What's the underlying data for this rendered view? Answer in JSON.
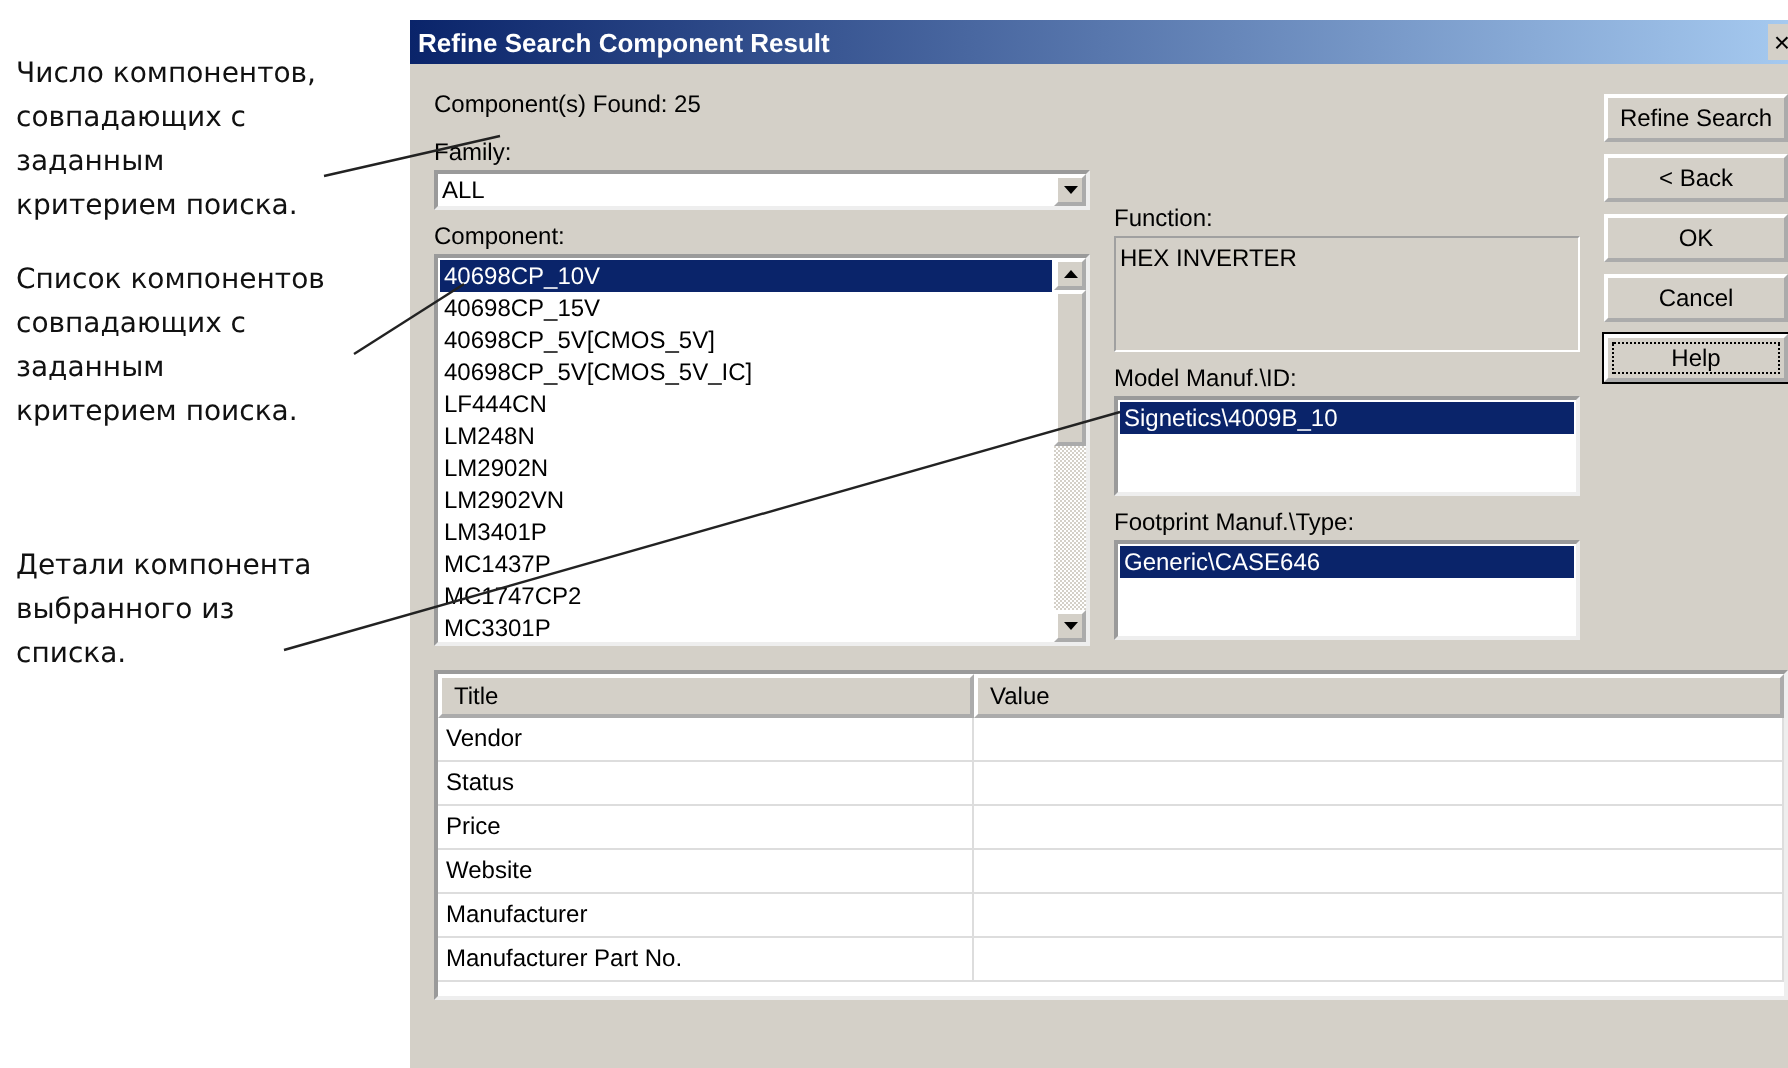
{
  "annotations": [
    "Число компонентов,\nсовпадающих с\nзаданным\nкритерием поиска.",
    "Список компонентов\nсовпадающих с\nзаданным\nкритерием поиска.",
    "Детали компонента\nвыбранного из\nсписка."
  ],
  "window": {
    "title": "Refine Search Component Result",
    "close": "×"
  },
  "found": "Component(s) Found: 25",
  "family": {
    "label": "Family:",
    "value": "ALL"
  },
  "component": {
    "label": "Component:",
    "items": [
      {
        "text": "40698CP_10V",
        "selected": true
      },
      {
        "text": "40698CP_15V",
        "selected": false
      },
      {
        "text": "40698CP_5V[CMOS_5V]",
        "selected": false
      },
      {
        "text": "40698CP_5V[CMOS_5V_IC]",
        "selected": false
      },
      {
        "text": "LF444CN",
        "selected": false
      },
      {
        "text": "LM248N",
        "selected": false
      },
      {
        "text": "LM2902N",
        "selected": false
      },
      {
        "text": "LM2902VN",
        "selected": false
      },
      {
        "text": "LM3401P",
        "selected": false
      },
      {
        "text": "MC1437P",
        "selected": false
      },
      {
        "text": "MC1747CP2",
        "selected": false
      },
      {
        "text": "MC3301P",
        "selected": false
      }
    ]
  },
  "function": {
    "label": "Function:",
    "value": "HEX INVERTER"
  },
  "model": {
    "label": "Model Manuf.\\ID:",
    "items": [
      {
        "text": "Signetics\\4009B_10",
        "selected": true
      }
    ]
  },
  "footprint": {
    "label": "Footprint Manuf.\\Type:",
    "items": [
      {
        "text": "Generic\\CASE646",
        "selected": true
      }
    ]
  },
  "buttons": [
    {
      "label": "Refine Search",
      "focused": false
    },
    {
      "label": "< Back",
      "focused": false
    },
    {
      "label": "OK",
      "focused": false
    },
    {
      "label": "Cancel",
      "focused": false
    },
    {
      "label": "Help",
      "focused": true
    }
  ],
  "table": {
    "columns": [
      "Title",
      "Value"
    ],
    "rows": [
      "Vendor",
      "Status",
      "Price",
      "Website",
      "Manufacturer",
      "Manufacturer Part No."
    ]
  }
}
